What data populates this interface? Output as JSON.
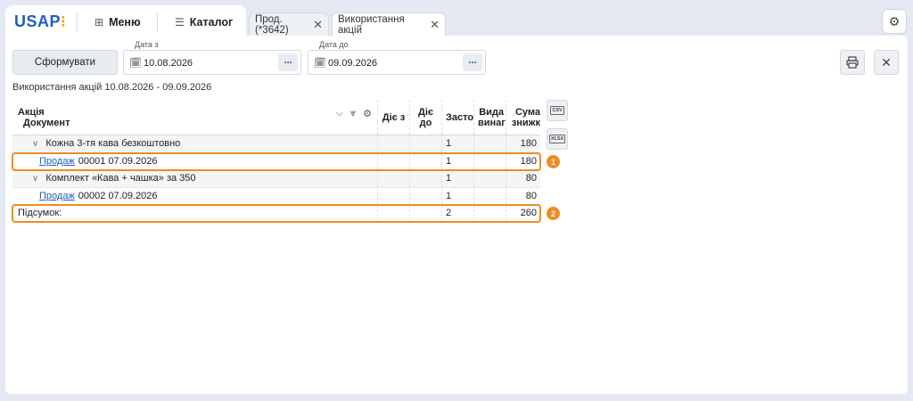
{
  "app": {
    "logo_text": "USAP",
    "logo_mark": "⁝",
    "menu_label": "Меню",
    "catalog_label": "Каталог"
  },
  "tabs": [
    {
      "label": "Прод. (*3642)",
      "active": false
    },
    {
      "label": "Використання акцій",
      "active": true
    }
  ],
  "toolbar": {
    "generate_label": "Сформувати",
    "date_from_label": "Дата з",
    "date_from_value": "10.08.2026",
    "date_to_label": "Дата до",
    "date_to_value": "09.09.2026",
    "more_label": "···"
  },
  "report": {
    "title": "Використання акцій 10.08.2026 - 09.09.2026"
  },
  "table": {
    "headers": {
      "col0_line1": "Акція",
      "col0_line2": "Документ",
      "col1": "Діє з",
      "col2_line1": "Діє",
      "col2_line2": "до",
      "col3": "Застос",
      "col4_line1": "Вида",
      "col4_line2": "винаго",
      "col5_line1": "Сума",
      "col5_line2": "знижк"
    },
    "rows": [
      {
        "type": "group",
        "name": "Кожна 3-тя кава безкоштовно",
        "applied": "1",
        "amount": "180"
      },
      {
        "type": "doc",
        "link": "Продаж",
        "doc": "00001 07.09.2026",
        "applied": "1",
        "amount": "180"
      },
      {
        "type": "group",
        "name": "Комплект «Кава + чашка» за 350",
        "applied": "1",
        "amount": "80"
      },
      {
        "type": "doc",
        "link": "Продаж",
        "doc": "00002 07.09.2026",
        "applied": "1",
        "amount": "80"
      }
    ],
    "total": {
      "label": "Підсумок:",
      "applied": "2",
      "amount": "260"
    }
  },
  "side_buttons": {
    "csv_label": "CSV",
    "xlsx_label": "XLSX"
  },
  "badges": [
    "1",
    "2"
  ],
  "colors": {
    "brand": "#1b5fc2",
    "highlight": "#ee8d20",
    "link": "#1b5fc2"
  }
}
